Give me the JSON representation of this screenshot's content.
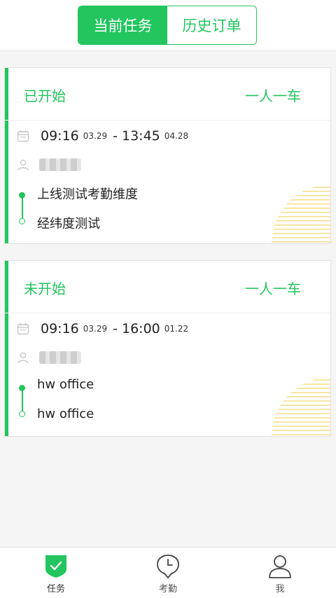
{
  "header": {
    "tabs": [
      {
        "label": "当前任务",
        "active": true
      },
      {
        "label": "历史订单",
        "active": false
      }
    ]
  },
  "tasks": [
    {
      "status": "已开始",
      "mode": "一人一车",
      "start_time": "09:16",
      "start_date": "03.29",
      "separator": "-",
      "end_time": "13:45",
      "end_date": "04.28",
      "from": "上线测试考勤维度",
      "to": "经纬度测试"
    },
    {
      "status": "未开始",
      "mode": "一人一车",
      "start_time": "09:16",
      "start_date": "03.29",
      "separator": "-",
      "end_time": "16:00",
      "end_date": "01.22",
      "from": "hw office",
      "to": "hw office"
    }
  ],
  "tabbar": {
    "items": [
      {
        "label": "任务",
        "icon": "shield-check-icon",
        "active": true
      },
      {
        "label": "考勤",
        "icon": "clock-pin-icon",
        "active": false
      },
      {
        "label": "我",
        "icon": "person-icon",
        "active": false
      }
    ]
  },
  "colors": {
    "accent": "#22c55e",
    "stripe": "#f6dd8a"
  }
}
